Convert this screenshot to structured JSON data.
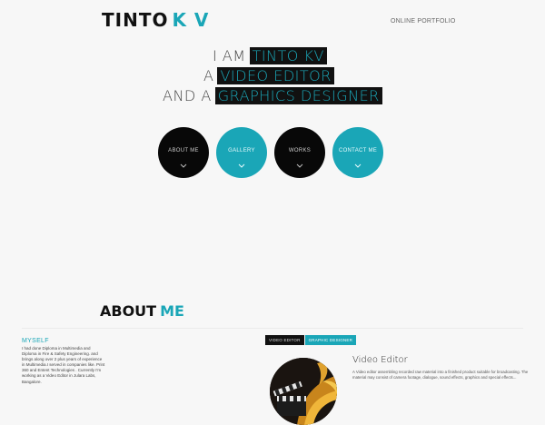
{
  "header": {
    "logo_name": "TINTO",
    "logo_accent": "K V",
    "tagline": "ONLINE PORTFOLIO"
  },
  "intro": {
    "line1_prefix": "I AM",
    "line1_highlight": "TINTO KV",
    "line2_prefix": "A",
    "line2_highlight": "VIDEO EDITOR",
    "line3_prefix": "AND A",
    "line3_highlight": "GRAPHICS DESIGNER"
  },
  "nav_circles": [
    {
      "label": "ABOUT ME",
      "style": "dark"
    },
    {
      "label": "GALLERY",
      "style": "teal"
    },
    {
      "label": "WORKS",
      "style": "dark"
    },
    {
      "label": "CONTACT ME",
      "style": "teal"
    }
  ],
  "about": {
    "title_main": "ABOUT",
    "title_accent": "ME",
    "myself_heading": "MYSELF",
    "myself_text": "I had done Diploma in Multimedia and Diploma in Fire & Safety Engineering. and brings along over 2 plus years of experience in Multimedia.I served in companies like. Print 360 and Entent Technologies . Currently I'm working as a Video Editor in Julara Labs, Bangalore."
  },
  "skills_tabs": [
    {
      "label": "VIDEO EDITOR",
      "active": true
    },
    {
      "label": "GRAPHIC DESIGNER",
      "active": false
    }
  ],
  "video_editor": {
    "title": "Video Editor",
    "description": "A Video editor assembling recorded raw material into a finished product suitable for broadcasting. The material may consist of camera footage, dialogue, sound effects, graphics and special effects...",
    "image_icon": "film-clapper-icon"
  },
  "colors": {
    "accent": "#1aa6b7",
    "dark": "#080808",
    "background": "#f7f7f7"
  }
}
